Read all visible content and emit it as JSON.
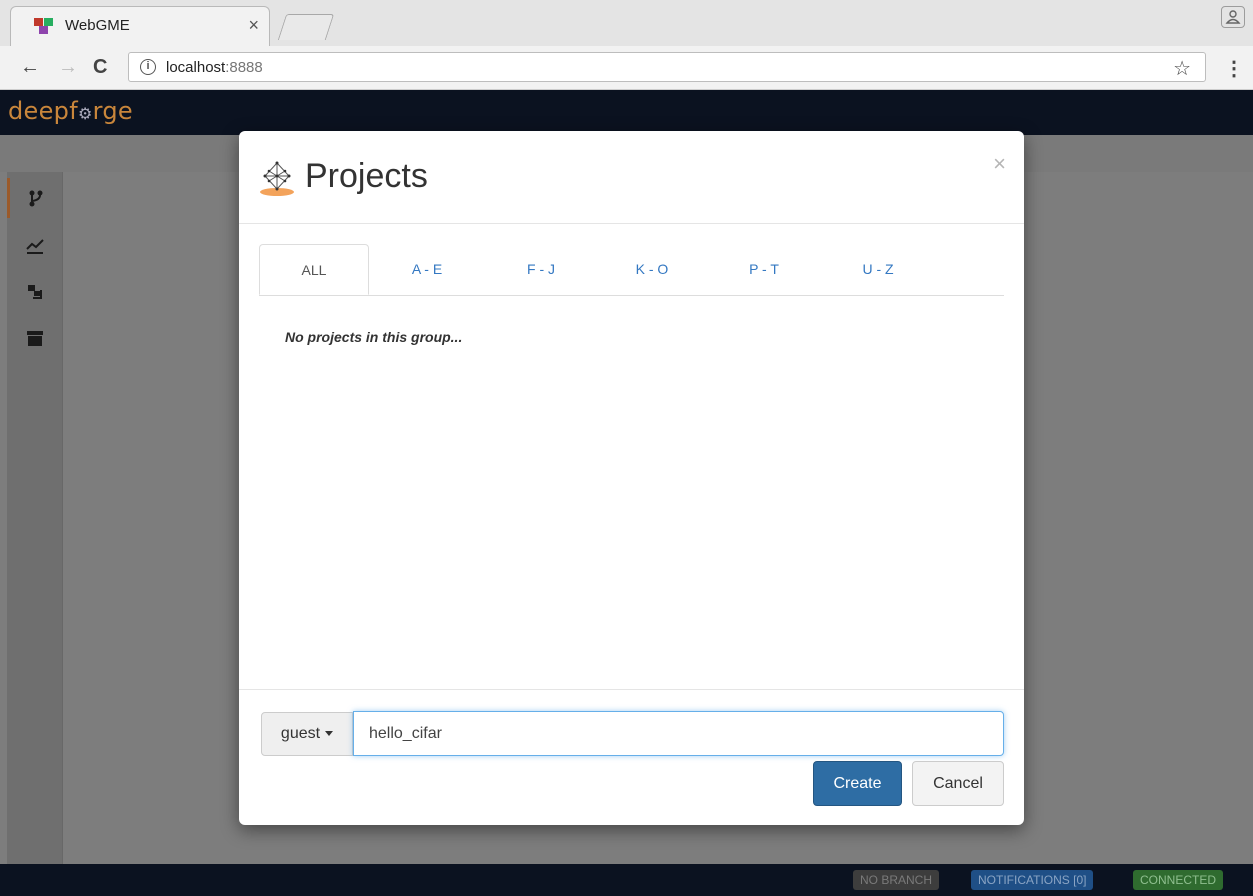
{
  "browser": {
    "tab_title": "WebGME",
    "tab_close": "×",
    "url_host": "localhost",
    "url_port": ":8888"
  },
  "app": {
    "logo_left": "deepf",
    "logo_mid": "⚙",
    "logo_right": "rge",
    "sidebar": [
      {
        "icon": "branch-icon",
        "active": true
      },
      {
        "icon": "chart-icon",
        "active": false
      },
      {
        "icon": "layers-icon",
        "active": false
      },
      {
        "icon": "archive-icon",
        "active": false
      }
    ]
  },
  "modal": {
    "title": "Projects",
    "close": "×",
    "tabs": [
      "ALL",
      "A - E",
      "F - J",
      "K - O",
      "P - T",
      "U - Z"
    ],
    "active_tab": "ALL",
    "empty_message": "No projects in this group...",
    "owner": "guest",
    "project_name_value": "hello_cifar",
    "create_label": "Create",
    "cancel_label": "Cancel"
  },
  "footer": {
    "branch": "NO BRANCH",
    "notifications": "NOTIFICATIONS [0]",
    "connection": "CONNECTED"
  },
  "colors": {
    "header_bg": "#0b1220",
    "primary": "#2e6da4",
    "link": "#3478c2",
    "connected": "#2f6b2f",
    "notifications": "#1f4f86"
  }
}
